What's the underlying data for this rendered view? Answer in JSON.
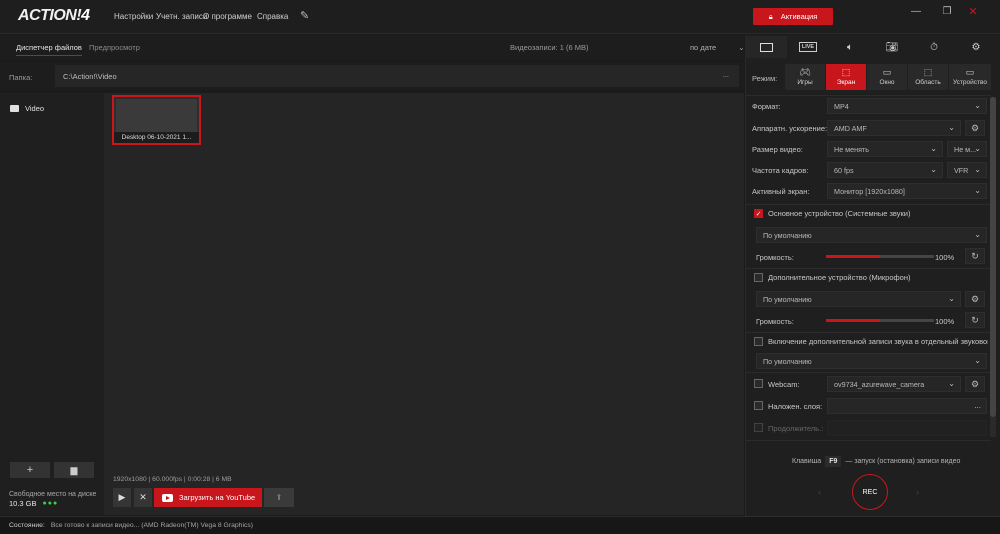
{
  "app": {
    "logo": "ACTION!",
    "logo_version": "4"
  },
  "menu": [
    "Настройки",
    "Учетн. записи",
    "О программе",
    "Справка"
  ],
  "activate_label": "Активация",
  "left_tabs": {
    "files": "Диспетчер файлов",
    "preview": "Предпросмотр"
  },
  "video_count": "Видеозаписи: 1 (6 MB)",
  "sort_label": "по дате",
  "folder": {
    "label": "Папка:",
    "path": "C:\\Action!\\Video",
    "more": "..."
  },
  "sidebar": {
    "video_item": "Video"
  },
  "thumb_caption": "Desktop 06-10-2021 1...",
  "file_info": "1920x1080 | 60.000fps | 0:00:28 | 6 MB",
  "youtube_label": "Загрузить на YouTube",
  "disk": {
    "label": "Свободное место на диске",
    "value": "10.3 GB",
    "dots": "●●●"
  },
  "status": {
    "label": "Состояние:",
    "text": "Все готово к записи видео...    (AMD Radeon(TM) Vega 8 Graphics)"
  },
  "mode_label": "Режим:",
  "modes": [
    "Игры",
    "Экран",
    "Окно",
    "Область",
    "Устройство"
  ],
  "settings": {
    "format_label": "Формат:",
    "format_value": "MP4",
    "accel_label": "Аппаратн. ускорение:",
    "accel_value": "AMD AMF",
    "size_label": "Размер видео:",
    "size_value": "Не менять",
    "size_value2": "Не м...",
    "fps_label": "Частота кадров:",
    "fps_value": "60 fps",
    "fps_value2": "VFR",
    "screen_label": "Активный экран:",
    "screen_value": "Монитор [1920x1080]",
    "main_device_label": "Основное устройство (Системные звуки)",
    "main_device_value": "По умолчанию",
    "volume_label": "Громкость:",
    "volume1": "100%",
    "volume1_level": 1.0,
    "extra_device_label": "Дополнительное устройство (Микрофон)",
    "extra_device_value": "По умолчанию",
    "volume2": "100%",
    "volume2_level": 1.0,
    "separate_audio_label": "Включение дополнительной записи звука в отдельный звуковой файл.",
    "separate_audio_value": "По умолчанию",
    "webcam_label": "Webcam:",
    "webcam_value": "ov9734_azurewave_camera",
    "overlay_label": "Наложен. слоя:",
    "overlay_more": "...",
    "duration_label": "Продолжитель.:"
  },
  "hotkey": {
    "prefix": "Клавиша",
    "key": "F9",
    "suffix": "— запуск (остановка) записи видео"
  },
  "rec_label": "REC",
  "colors": {
    "accent": "#c8161d",
    "background": "#1b1b1b",
    "ok": "#3ccf4e"
  }
}
